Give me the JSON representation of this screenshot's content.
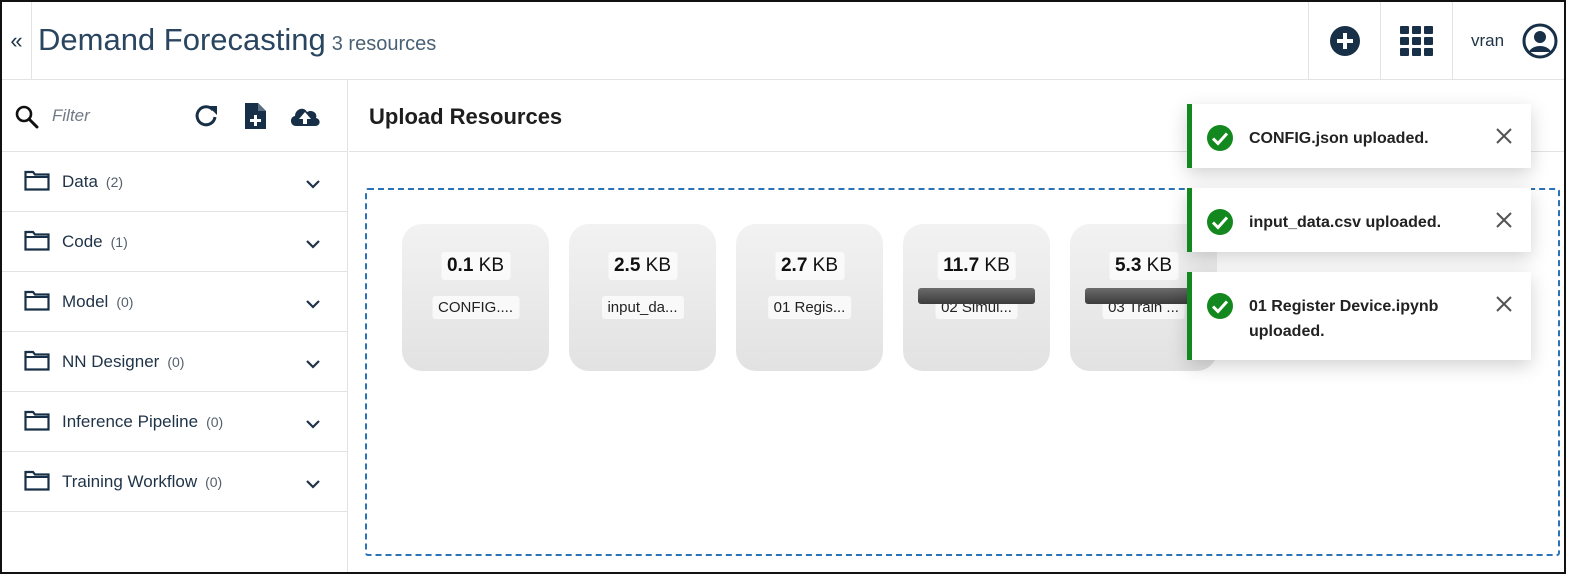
{
  "header": {
    "collapse_label": "«",
    "title": "Demand Forecasting",
    "resource_count": "3 resources",
    "user_name": "vran",
    "add_icon": "plus-circle-icon",
    "apps_icon": "apps-grid-icon",
    "user_icon": "user-circle-icon"
  },
  "sidebar": {
    "filter_placeholder": "Filter",
    "tools": [
      "refresh-icon",
      "new-file-icon",
      "cloud-upload-icon"
    ],
    "categories": [
      {
        "label": "Data",
        "count": "(2)"
      },
      {
        "label": "Code",
        "count": "(1)"
      },
      {
        "label": "Model",
        "count": "(0)"
      },
      {
        "label": "NN Designer",
        "count": "(0)"
      },
      {
        "label": "Inference Pipeline",
        "count": "(0)"
      },
      {
        "label": "Training Workflow",
        "count": "(0)"
      }
    ]
  },
  "main": {
    "title": "Upload Resources",
    "files": [
      {
        "size": "0.1",
        "unit": "KB",
        "name": "CONFIG....",
        "uploading": false
      },
      {
        "size": "2.5",
        "unit": "KB",
        "name": "input_da...",
        "uploading": false
      },
      {
        "size": "2.7",
        "unit": "KB",
        "name": "01 Regis...",
        "uploading": false
      },
      {
        "size": "11.7",
        "unit": "KB",
        "name": "02 Simul...",
        "uploading": true
      },
      {
        "size": "5.3",
        "unit": "KB",
        "name": "03 Train ...",
        "uploading": true
      }
    ]
  },
  "toasts": [
    {
      "message": "CONFIG.json uploaded."
    },
    {
      "message": "input_data.csv uploaded."
    },
    {
      "message": "01 Register Device.ipynb uploaded."
    }
  ],
  "colors": {
    "accent": "#2a73b6",
    "success": "#12881e",
    "text": "#1f3347"
  }
}
